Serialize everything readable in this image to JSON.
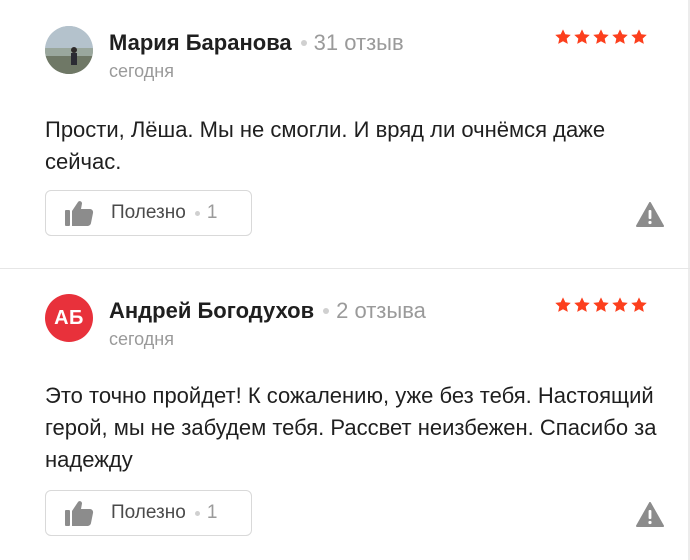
{
  "reviews": [
    {
      "author": "Мария Баранова",
      "review_count": "31 отзыв",
      "date": "сегодня",
      "rating": 5,
      "text": "Прости, Лёша. Мы не смогли. И вряд ли очнёмся даже сейчас.",
      "helpful_label": "Полезно",
      "helpful_count": "1",
      "avatar": "photo"
    },
    {
      "author": "Андрей Богодухов",
      "review_count": "2 отзыва",
      "date": "сегодня",
      "rating": 5,
      "text": "Это точно пройдет! К сожалению, уже без тебя. Настоящий герой, мы не забудем тебя. Рассвет неизбежен. Спасибо за надежду",
      "helpful_label": "Полезно",
      "helpful_count": "1",
      "avatar_initials": "АБ"
    }
  ],
  "colors": {
    "star": "#fc3f1d",
    "avatar_initials_bg": "#e8313b",
    "muted_text": "#9a9a9a",
    "report_icon": "#8c8c8c"
  },
  "icons": [
    "star-icon",
    "thumbs-up-icon",
    "warning-icon"
  ]
}
